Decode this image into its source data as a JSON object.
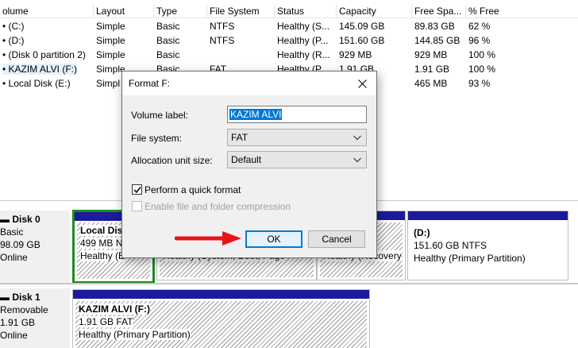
{
  "columns": [
    "olume",
    "Layout",
    "Type",
    "File System",
    "Status",
    "Capacity",
    "Free Spa...",
    "% Free"
  ],
  "volumes": [
    {
      "name": "(C:)",
      "layout": "Simple",
      "type": "Basic",
      "fs": "NTFS",
      "status": "Healthy (S...",
      "capacity": "145.09 GB",
      "free": "89.83 GB",
      "pct": "62 %"
    },
    {
      "name": "(D:)",
      "layout": "Simple",
      "type": "Basic",
      "fs": "NTFS",
      "status": "Healthy (P...",
      "capacity": "151.60 GB",
      "free": "144.85 GB",
      "pct": "96 %"
    },
    {
      "name": "(Disk 0 partition 2)",
      "layout": "Simple",
      "type": "Basic",
      "fs": "",
      "status": "Healthy (R...",
      "capacity": "929 MB",
      "free": "929 MB",
      "pct": "100 %"
    },
    {
      "name": "KAZIM ALVI (F:)",
      "layout": "Simple",
      "type": "Basic",
      "fs": "FAT",
      "status": "Healthy (P...",
      "capacity": "1.91 GB",
      "free": "1.91 GB",
      "pct": "100 %"
    },
    {
      "name": "Local Disk (E:)",
      "layout": "Simpl",
      "type": "",
      "fs": "",
      "status": "",
      "capacity": "",
      "free": "465 MB",
      "pct": "93 %"
    }
  ],
  "disks": [
    {
      "name": "Disk 0",
      "kind": "Basic",
      "size": "98.09 GB",
      "state": "Online"
    },
    {
      "name": "Disk 1",
      "kind": "Removable",
      "size": "1.91 GB",
      "state": "Online"
    }
  ],
  "partitions": {
    "local_e": {
      "title": "Local Disk",
      "line2": "499 MB N",
      "line3": "Healthy (E"
    },
    "c_part": {
      "line3": "Healthy (System, Boot, Page"
    },
    "recovery": {
      "line3": "Healthy (Recovery"
    },
    "d_part": {
      "title": "(D:)",
      "line2": "151.60 GB NTFS",
      "line3": "Healthy (Primary Partition)"
    },
    "f_part": {
      "title": "KAZIM ALVI  (F:)",
      "line2": "1.91 GB FAT",
      "line3": "Healthy (Primary Partition)"
    }
  },
  "dialog": {
    "title": "Format F:",
    "volume_label_caption": "Volume label:",
    "volume_label_value": "KAZIM ALVI",
    "file_system_caption": "File system:",
    "file_system_value": "FAT",
    "alloc_caption": "Allocation unit size:",
    "alloc_value": "Default",
    "quick_format": "Perform a quick format",
    "compression": "Enable file and folder compression",
    "ok": "OK",
    "cancel": "Cancel"
  },
  "colors": {
    "accent": "#0078d7",
    "partition_bar": "#1b1b9c",
    "arrow": "#e8141b",
    "selection": "#1e8a1e"
  }
}
